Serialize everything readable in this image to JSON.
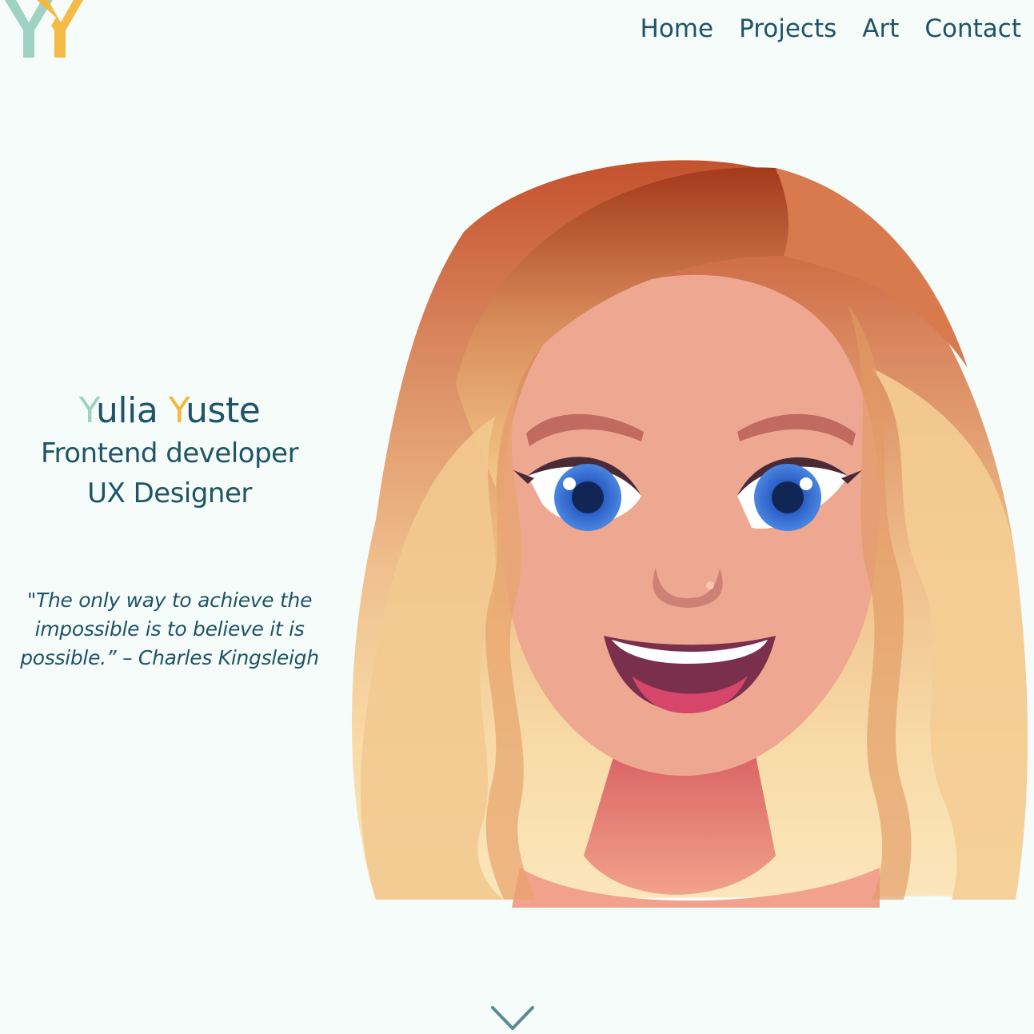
{
  "logo": {
    "letters": "YY",
    "colors": {
      "first": "#9fd2c3",
      "second": "#f3b73c"
    }
  },
  "nav": {
    "items": [
      {
        "label": "Home"
      },
      {
        "label": "Projects"
      },
      {
        "label": "Art"
      },
      {
        "label": "Contact"
      }
    ],
    "color": "#1f5466"
  },
  "hero": {
    "name": {
      "first_initial": "Y",
      "first_rest": "ulia",
      "last_initial": "Y",
      "last_rest": "uste"
    },
    "roles": [
      "Frontend developer",
      "UX Designer"
    ],
    "quote": "\"The only way to achieve the impossible is to believe it is possible.” – Charles Kingsleigh"
  },
  "avatar": {
    "icon": "illustrated-portrait"
  },
  "scroll": {
    "icon": "chevron-down-icon"
  },
  "colors": {
    "background": "#f5fcf9",
    "text": "#1f5466",
    "accent_mint": "#9fd2c3",
    "accent_yellow": "#f3b73c"
  }
}
